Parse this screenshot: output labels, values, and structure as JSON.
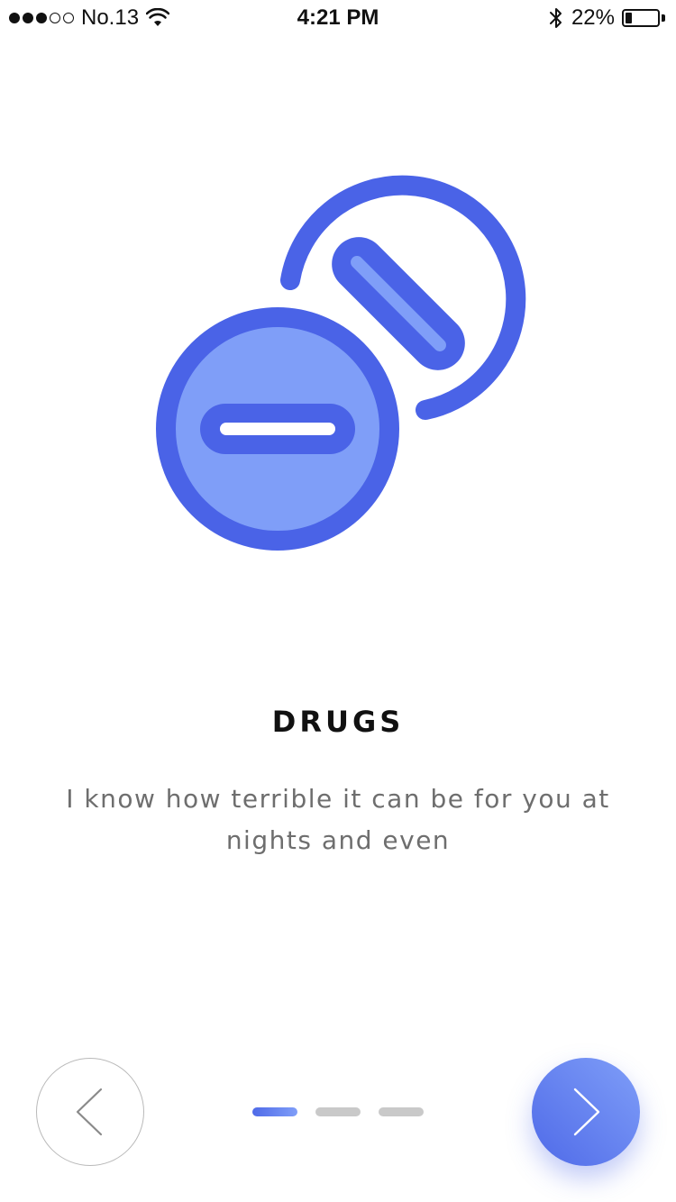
{
  "status_bar": {
    "carrier": "No.13",
    "time": "4:21 PM",
    "battery_percent": "22%",
    "battery_level": 0.22,
    "signal_bars_filled": 3,
    "signal_bars_total": 5
  },
  "onboarding": {
    "title": "DRUGS",
    "description": "I know how terrible it can be for you at nights and even",
    "illustration_icon": "pills-icon"
  },
  "pager": {
    "total_pages": 3,
    "current_page": 1
  },
  "navigation": {
    "prev_icon": "chevron-left-icon",
    "next_icon": "chevron-right-icon"
  },
  "colors": {
    "accent_dark": "#4a63e7",
    "accent_light": "#7f9ef8",
    "inactive_dash": "#c9c9c9"
  }
}
